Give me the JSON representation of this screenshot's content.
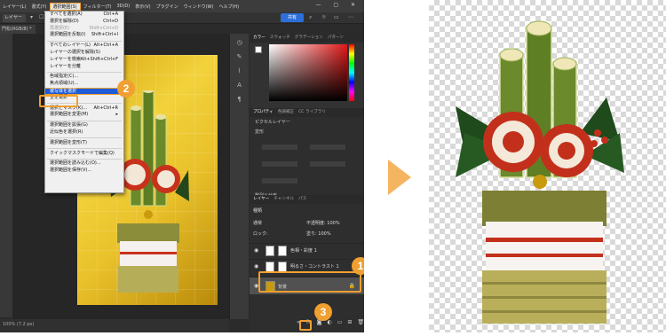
{
  "menubar": {
    "items": [
      "レイヤー(L)",
      "書式(Y)",
      "選択範囲(S)",
      "フィルター(T)",
      "3D(D)",
      "表示(V)",
      "プラグイン",
      "ウィンドウ(W)",
      "ヘルプ(H)"
    ],
    "active_index": 2
  },
  "optionsbar": {
    "layer_label": "レイヤー",
    "share_label": "共有"
  },
  "doc_tab": "門松(RGB/8) *",
  "status_text": "100% (7.2 px)",
  "select_menu": {
    "items": [
      {
        "label": "すべてを選択(A)",
        "shortcut": "Ctrl+A"
      },
      {
        "label": "選択を解除(D)",
        "shortcut": "Ctrl+D"
      },
      {
        "label": "再選択(E)",
        "shortcut": "Shift+Ctrl+D",
        "disabled": true
      },
      {
        "label": "選択範囲を反転(I)",
        "shortcut": "Shift+Ctrl+I"
      },
      {
        "sep": true
      },
      {
        "label": "すべてのレイヤー(L)",
        "shortcut": "Alt+Ctrl+A"
      },
      {
        "label": "レイヤーの選択を解除(S)",
        "shortcut": ""
      },
      {
        "label": "レイヤーを検索",
        "shortcut": "Alt+Shift+Ctrl+F"
      },
      {
        "label": "レイヤーを分離",
        "shortcut": ""
      },
      {
        "sep": true
      },
      {
        "label": "色域指定(C)...",
        "shortcut": ""
      },
      {
        "label": "焦点領域(U)...",
        "shortcut": ""
      },
      {
        "label": "被写体を選択",
        "shortcut": "",
        "highlight": true
      },
      {
        "label": "空を選択",
        "shortcut": ""
      },
      {
        "sep": true
      },
      {
        "label": "選択とマスク(K)...",
        "shortcut": "Alt+Ctrl+R"
      },
      {
        "label": "選択範囲を変更(M)",
        "shortcut": "▸"
      },
      {
        "sep": true
      },
      {
        "label": "選択範囲を拡張(G)",
        "shortcut": ""
      },
      {
        "label": "近似色を選択(R)",
        "shortcut": ""
      },
      {
        "sep": true
      },
      {
        "label": "選択範囲を変形(T)",
        "shortcut": ""
      },
      {
        "sep": true
      },
      {
        "label": "クイックマスクモードで編集(Q)",
        "shortcut": ""
      },
      {
        "sep": true
      },
      {
        "label": "選択範囲を読み込む(O)...",
        "shortcut": ""
      },
      {
        "label": "選択範囲を保存(V)...",
        "shortcut": ""
      }
    ]
  },
  "color_panel": {
    "tabs": [
      "カラー",
      "スウォッチ",
      "グラデーション",
      "パターン"
    ]
  },
  "properties_panel": {
    "tabs": [
      "プロパティ",
      "色調補正",
      "CC ライブラリ"
    ],
    "layer_kind": "ピクセルレイヤー",
    "section_transform": "変形",
    "section_align": "整列と分布"
  },
  "layers_panel": {
    "tabs": [
      "レイヤー",
      "チャンネル",
      "パス"
    ],
    "filter_label": "種類",
    "mode_label": "通常",
    "opacity_label": "不透明度:",
    "opacity_value": "100%",
    "lock_label": "ロック:",
    "fill_label": "塗り:",
    "fill_value": "100%",
    "layers": [
      {
        "name": "色相・彩度 1"
      },
      {
        "name": "明るさ・コントラスト 1"
      },
      {
        "name": "背景",
        "selected": true
      }
    ]
  },
  "badges": [
    "1",
    "2",
    "3"
  ],
  "colors": {
    "accent_orange": "#f0a030",
    "highlight_blue": "#1e5bd6",
    "share_blue": "#2d6fd9"
  }
}
